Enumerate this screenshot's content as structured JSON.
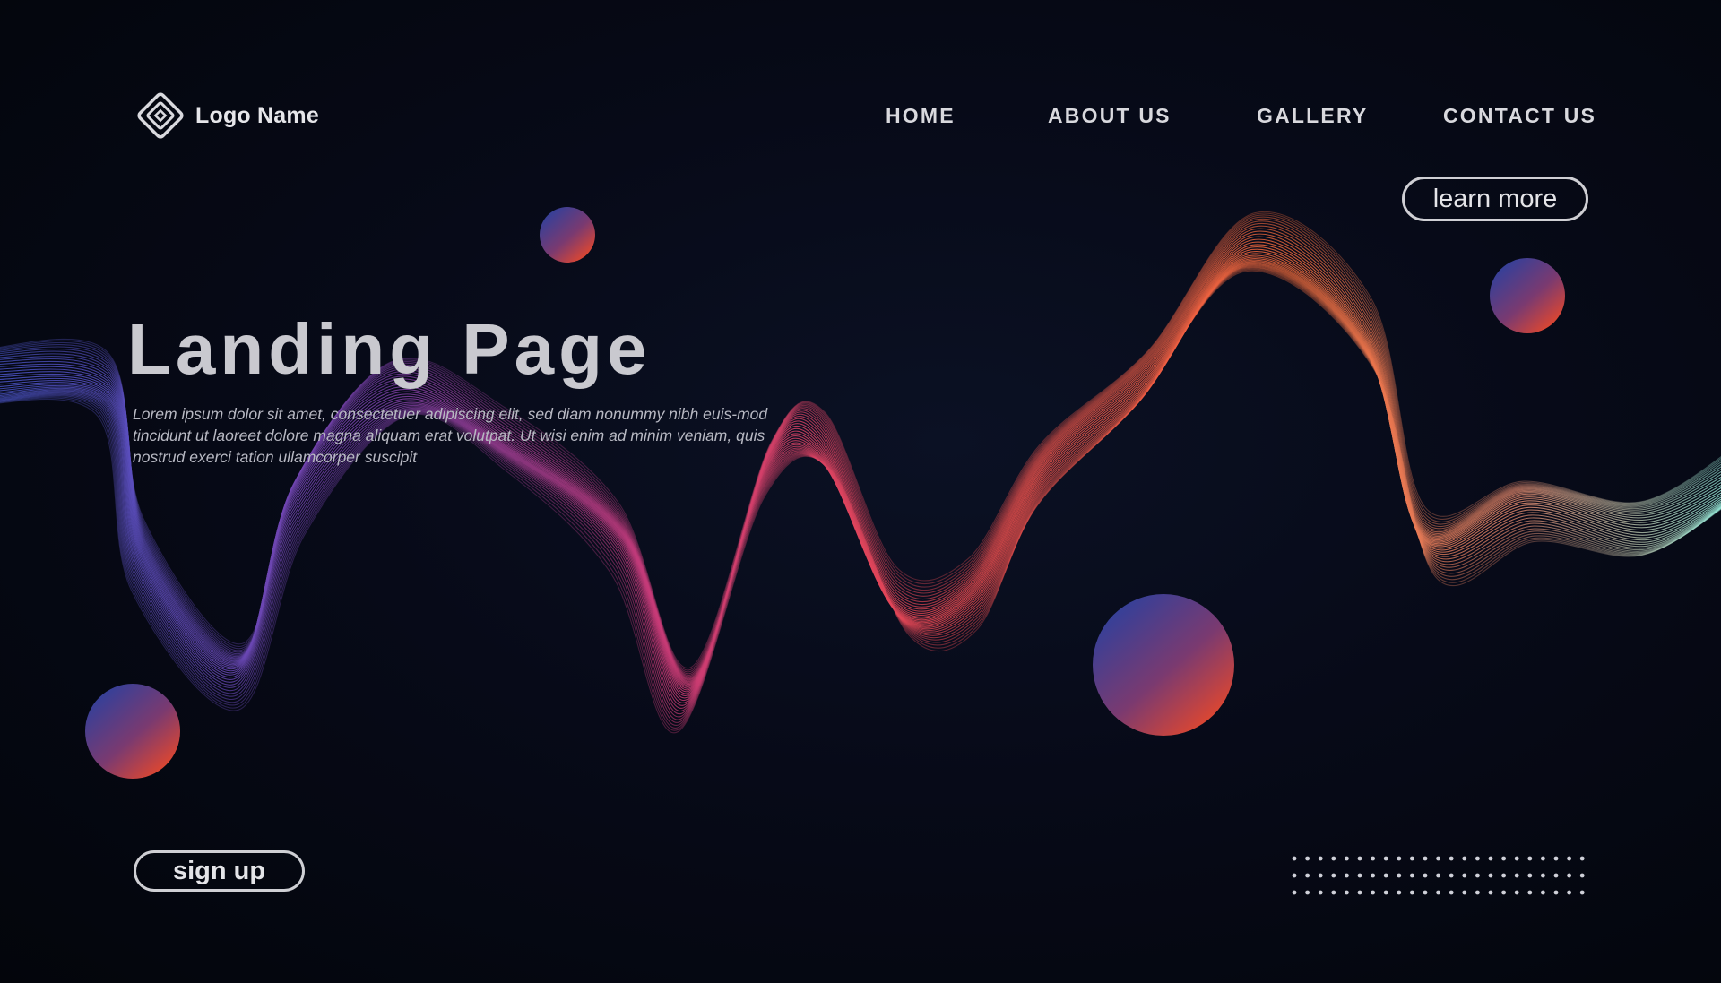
{
  "logo": {
    "icon": "diamond-logo-icon",
    "name": "Logo Name"
  },
  "nav": {
    "items": [
      {
        "label": "HOME"
      },
      {
        "label": "ABOUT US"
      },
      {
        "label": "GALLERY"
      },
      {
        "label": "CONTACT US"
      }
    ]
  },
  "hero": {
    "title": "Landing Page",
    "description": "Lorem ipsum dolor sit amet, consectetuer adipiscing elit, sed diam nonummy nibh euis-mod tincidunt ut laoreet dolore magna aliquam erat volutpat. Ut wisi enim ad minim veniam, quis nostrud exerci tation ullamcorper suscipit"
  },
  "buttons": {
    "learn_more": "learn more",
    "sign_up": "sign up"
  },
  "colors": {
    "background": "#05070f",
    "text": "#d9d9de",
    "wave_blue": "#4a55c8",
    "wave_magenta": "#c83a78",
    "wave_red": "#e84850",
    "wave_orange": "#f06a3a",
    "wave_teal": "#8fe0d0",
    "sphere_top": "#3d3f8f",
    "sphere_bottom": "#d24a35"
  }
}
